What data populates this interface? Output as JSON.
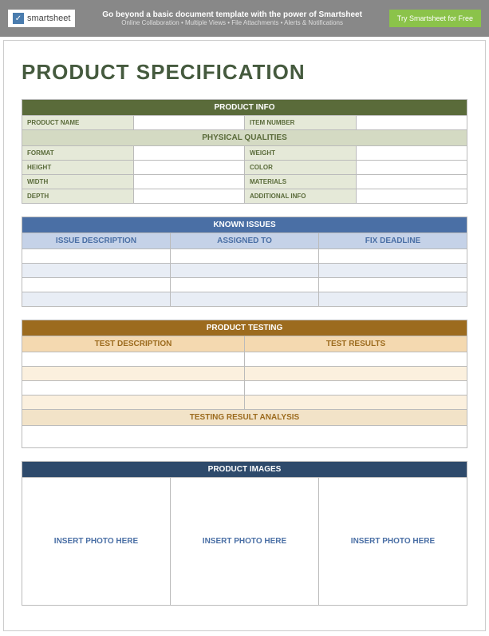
{
  "banner": {
    "logo_text": "smartsheet",
    "title": "Go beyond a basic document template with the power of Smartsheet",
    "subtitle": "Online Collaboration • Multiple Views • File Attachments • Alerts & Notifications",
    "button": "Try Smartsheet for Free"
  },
  "doc_title": "PRODUCT SPECIFICATION",
  "product_info": {
    "header": "PRODUCT INFO",
    "product_name_label": "PRODUCT NAME",
    "product_name_value": "",
    "item_number_label": "ITEM NUMBER",
    "item_number_value": "",
    "physical_header": "PHYSICAL QUALITIES",
    "rows": [
      {
        "left_label": "FORMAT",
        "left_value": "",
        "right_label": "WEIGHT",
        "right_value": ""
      },
      {
        "left_label": "HEIGHT",
        "left_value": "",
        "right_label": "COLOR",
        "right_value": ""
      },
      {
        "left_label": "WIDTH",
        "left_value": "",
        "right_label": "MATERIALS",
        "right_value": ""
      },
      {
        "left_label": "DEPTH",
        "left_value": "",
        "right_label": "ADDITIONAL INFO",
        "right_value": ""
      }
    ]
  },
  "known_issues": {
    "header": "KNOWN ISSUES",
    "col_desc": "ISSUE DESCRIPTION",
    "col_assigned": "ASSIGNED TO",
    "col_deadline": "FIX DEADLINE",
    "rows": [
      {
        "desc": "",
        "assigned": "",
        "deadline": ""
      },
      {
        "desc": "",
        "assigned": "",
        "deadline": ""
      },
      {
        "desc": "",
        "assigned": "",
        "deadline": ""
      },
      {
        "desc": "",
        "assigned": "",
        "deadline": ""
      }
    ]
  },
  "testing": {
    "header": "PRODUCT TESTING",
    "col_desc": "TEST DESCRIPTION",
    "col_results": "TEST RESULTS",
    "rows": [
      {
        "desc": "",
        "results": ""
      },
      {
        "desc": "",
        "results": ""
      },
      {
        "desc": "",
        "results": ""
      },
      {
        "desc": "",
        "results": ""
      }
    ],
    "analysis_header": "TESTING RESULT ANALYSIS",
    "analysis_value": ""
  },
  "images": {
    "header": "PRODUCT IMAGES",
    "placeholder1": "INSERT PHOTO HERE",
    "placeholder2": "INSERT PHOTO HERE",
    "placeholder3": "INSERT PHOTO HERE"
  }
}
